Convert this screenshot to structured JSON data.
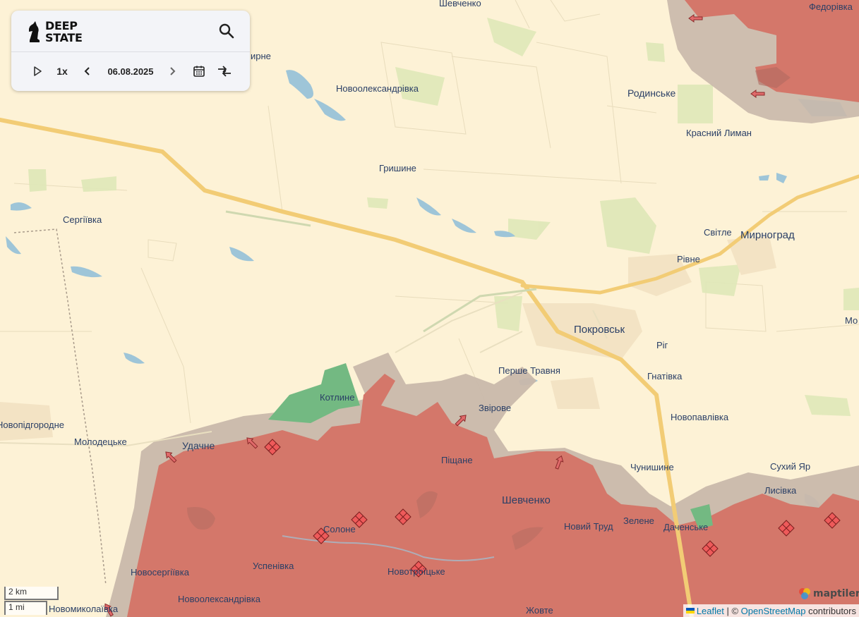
{
  "header": {
    "logo_line1": "DEEP",
    "logo_line2": "STATE"
  },
  "player": {
    "speed": "1x",
    "date": "06.08.2025"
  },
  "icons": {
    "logo": "chess-knight-icon",
    "search": "search-icon",
    "play": "play-icon",
    "prev": "chevron-left-icon",
    "next": "chevron-right-icon",
    "calendar": "calendar-icon",
    "compare": "compare-arrows-icon",
    "attack": "attack-arrow-icon",
    "hit": "strike-diamond-icon"
  },
  "colors": {
    "land": "#fdf2d6",
    "occupied": "#d4776a",
    "grey_zone": "#c9b8ab",
    "liberated": "#73b982",
    "road": "#f2cc75",
    "water": "#9ec5d8",
    "label": "#2a3f66"
  },
  "places": {
    "pokrovsk": "Покровськ",
    "myrnohrad": "Мирноград",
    "rodynske": "Родинське",
    "krasnyi_lyman": "Красний Лиман",
    "fedorivka": "Федорівка",
    "shevchenko_top": "Шевченко",
    "novooleksandrivka_top": "Новоолександрівка",
    "myrne": "ирне",
    "hryshyne": "Гришине",
    "serhiivka": "Сергіївка",
    "svitle": "Світле",
    "rivne": "Рівне",
    "rih": "Ріг",
    "hnativka": "Гнатівка",
    "mo": "Мо",
    "kotlyne": "Котлине",
    "pershe_travnia": "Перше Травня",
    "zvirove": "Звірове",
    "udachne": "Удачне",
    "molodetske": "Молодецьке",
    "novopidhorodne": "Новопідгородне",
    "novopavlivka": "Новопавлівка",
    "pishchane": "Піщане",
    "chunyshyne": "Чунишине",
    "sukhyi_yar": "Сухий Яр",
    "lysivka": "Лисівка",
    "shevchenko": "Шевченко",
    "novyi_trud": "Новий Труд",
    "zelene": "Зелене",
    "dachenske": "Даченське",
    "solone": "Солоне",
    "uspenivka": "Успенівка",
    "novoserhiivka": "Новосергіївка",
    "novotroitske": "Новотроїцьке",
    "novooleksandrivka": "Новоолександрівка",
    "novomykolaivka": "Новомиколаївка",
    "zhovte": "Жовте"
  },
  "scale": {
    "metric": "2 km",
    "imperial": "1 mi"
  },
  "attribution": {
    "leaflet": "Leaflet",
    "separator": " | © ",
    "osm": "OpenStreetMap",
    "suffix": " contributors",
    "maptiler": "maptiler"
  }
}
